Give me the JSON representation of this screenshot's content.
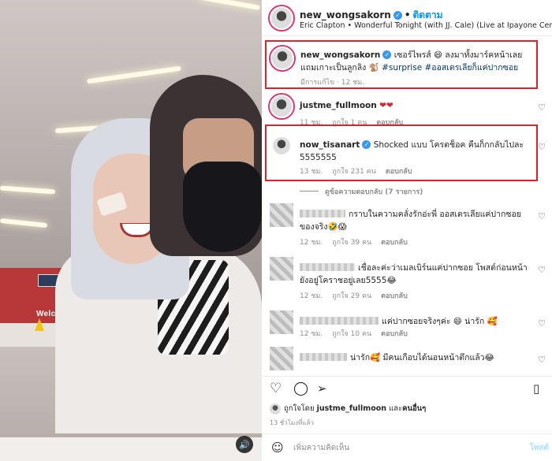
{
  "header": {
    "username": "new_wongsakorn",
    "follow_label": "ติดตาม",
    "music": "Eric Clapton • Wonderful Tonight (with JJ. Cale) (Live at Ipayone Center, ..."
  },
  "caption": {
    "username": "new_wongsakorn",
    "text": "เซอร์ไพรส์ 😄 ลงมาทั้งมาร์คหน้าเลย แถมเกาะเป็นลูกลิง 🐒",
    "hashtags": "#surprise #ออสเตรเลียก็แค่ปากซอย",
    "meta": "มีการแก้ไข · 12 ชม."
  },
  "comments": [
    {
      "username": "justme_fullmoon",
      "text": "❤❤",
      "time": "11 ชม.",
      "likes": "ถูกใจ 1 คน",
      "reply": "ตอบกลับ"
    },
    {
      "username": "now_tisanart",
      "text": "Shocked แบบ โครตช็อค คืนก็กกลับไปละ 5555555",
      "time": "13 ชม.",
      "likes": "ถูกใจ 231 คน",
      "reply": "ตอบกลับ"
    },
    {
      "username": "",
      "text": "กราบในความคลั่งรักอ่ะพี่ ออสเตรเลียแค่ปากซอยของจริง🤣😱",
      "time": "12 ชม.",
      "likes": "ถูกใจ 39 คน",
      "reply": "ตอบกลับ"
    },
    {
      "username": "",
      "text": "เชื่อละค่ะว่าเมลเบิร์นแค่ปากซอย โพสต์ก่อนหน้ายังอยู่โคราชอยู่เลย5555😂",
      "time": "12 ชม.",
      "likes": "ถูกใจ 29 คน",
      "reply": "ตอบกลับ"
    },
    {
      "username": "",
      "text": "แค่ปากซอยจริงๆค่ะ 😄 น่ารัก 🥰",
      "time": "12 ชม.",
      "likes": "ถูกใจ 10 คน",
      "reply": "ตอบกลับ"
    },
    {
      "username": "",
      "text": "น่ารัก🥰 มีคนเกือบได้นอนหน้าตึกแล้ว😂",
      "time": "",
      "likes": "",
      "reply": ""
    }
  ],
  "view_replies": "ดูข้อความตอบกลับ (7 รายการ)",
  "liked_by": {
    "prefix": "ถูกใจโดย",
    "user": "justme_fullmoon",
    "connector": "และ",
    "others": "คนอื่นๆ"
  },
  "time_ago": "13 ชั่วโมงที่แล้ว",
  "add_comment": {
    "emoji": "☺",
    "placeholder": "เพิ่มความคิดเห็น",
    "post_label": "โพสต์"
  },
  "photo": {
    "sign_text": "Welcome"
  },
  "colors": {
    "highlight_box": "#e0212a",
    "link_blue": "#0095f6",
    "meta_gray": "#8e8e8e"
  }
}
